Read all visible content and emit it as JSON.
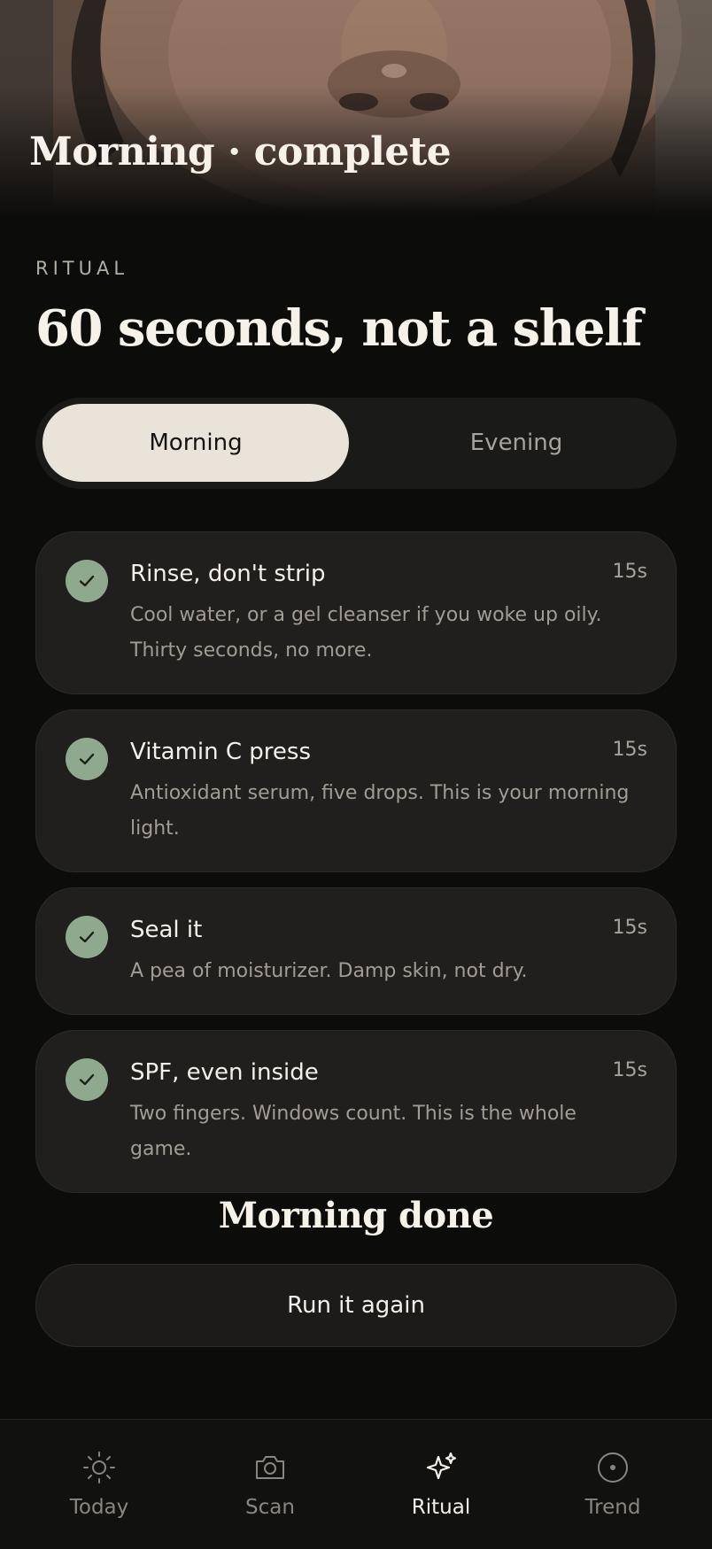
{
  "hero": {
    "title": "Morning · complete"
  },
  "header": {
    "eyebrow": "RITUAL",
    "title": "60 seconds, not a shelf"
  },
  "toggle": {
    "options": [
      "Morning",
      "Evening"
    ],
    "selected": "Morning"
  },
  "steps": [
    {
      "title": "Rinse, don't strip",
      "duration": "15s",
      "description": "Cool water, or a gel cleanser if you woke up oily. Thirty seconds, no more.",
      "done": true
    },
    {
      "title": "Vitamin C press",
      "duration": "15s",
      "description": "Antioxidant serum, five drops. This is your morning light.",
      "done": true
    },
    {
      "title": "Seal it",
      "duration": "15s",
      "description": "A pea of moisturizer. Damp skin, not dry.",
      "done": true
    },
    {
      "title": "SPF, even inside",
      "duration": "15s",
      "description": "Two fingers. Windows count. This is the whole game.",
      "done": true
    }
  ],
  "completion": {
    "title": "Morning done",
    "button_label": "Run it again"
  },
  "nav": {
    "items": [
      {
        "label": "Today",
        "icon": "sun-icon"
      },
      {
        "label": "Scan",
        "icon": "camera-icon"
      },
      {
        "label": "Ritual",
        "icon": "sparkle-icon"
      },
      {
        "label": "Trend",
        "icon": "target-icon"
      }
    ],
    "active": "Ritual"
  },
  "colors": {
    "background": "#0c0c0b",
    "card": "#211f1d",
    "check": "#8fa98e",
    "toggle_active": "#e9e3da"
  }
}
